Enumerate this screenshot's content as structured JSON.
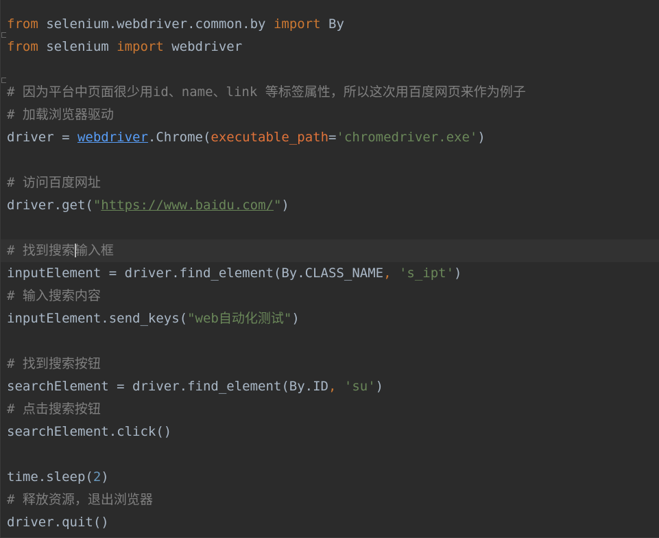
{
  "editor": {
    "lines": [
      [
        {
          "t": "kw",
          "v": "from"
        },
        {
          "t": "id",
          "v": " selenium.webdriver.common.by "
        },
        {
          "t": "kw",
          "v": "import"
        },
        {
          "t": "id",
          "v": " By"
        }
      ],
      [
        {
          "t": "kw",
          "v": "from"
        },
        {
          "t": "id",
          "v": " selenium "
        },
        {
          "t": "kw",
          "v": "import"
        },
        {
          "t": "id",
          "v": " webdriver"
        }
      ],
      [],
      [
        {
          "t": "cm",
          "v": "# 因为平台中页面很少用id、name、link 等标签属性，所以这次用百度网页来作为例子"
        }
      ],
      [
        {
          "t": "cm",
          "v": "# 加载浏览器驱动"
        }
      ],
      [
        {
          "t": "id",
          "v": "driver = "
        },
        {
          "t": "link",
          "v": "webdriver"
        },
        {
          "t": "id",
          "v": ".Chrome("
        },
        {
          "t": "param",
          "v": "executable_path"
        },
        {
          "t": "id",
          "v": "="
        },
        {
          "t": "str",
          "v": "'chromedriver.exe'"
        },
        {
          "t": "id",
          "v": ")"
        }
      ],
      [],
      [
        {
          "t": "cm",
          "v": "# 访问百度网址"
        }
      ],
      [
        {
          "t": "id",
          "v": "driver.get("
        },
        {
          "t": "str",
          "v": "\""
        },
        {
          "t": "url",
          "v": "https://www.baidu.com/"
        },
        {
          "t": "str",
          "v": "\""
        },
        {
          "t": "id",
          "v": ")"
        }
      ],
      [],
      [
        {
          "t": "cm",
          "v": "# 找到搜索输入框"
        }
      ],
      [
        {
          "t": "id",
          "v": "inputElement = driver.find_element(By.CLASS_NAME"
        },
        {
          "t": "punc",
          "v": ", "
        },
        {
          "t": "str",
          "v": "'s_ipt'"
        },
        {
          "t": "id",
          "v": ")"
        }
      ],
      [
        {
          "t": "cm",
          "v": "# 输入搜索内容"
        }
      ],
      [
        {
          "t": "id",
          "v": "inputElement.send_keys("
        },
        {
          "t": "str",
          "v": "\"web自动化测试\""
        },
        {
          "t": "id",
          "v": ")"
        }
      ],
      [],
      [
        {
          "t": "cm",
          "v": "# 找到搜索按钮"
        }
      ],
      [
        {
          "t": "id",
          "v": "searchElement = driver.find_element(By.ID"
        },
        {
          "t": "punc",
          "v": ", "
        },
        {
          "t": "str",
          "v": "'su'"
        },
        {
          "t": "id",
          "v": ")"
        }
      ],
      [
        {
          "t": "cm",
          "v": "# 点击搜索按钮"
        }
      ],
      [
        {
          "t": "id",
          "v": "searchElement.click()"
        }
      ],
      [],
      [
        {
          "t": "id",
          "v": "time.sleep("
        },
        {
          "t": "num",
          "v": "2"
        },
        {
          "t": "id",
          "v": ")"
        }
      ],
      [
        {
          "t": "cm",
          "v": "# 释放资源，退出浏览器"
        }
      ],
      [
        {
          "t": "id",
          "v": "driver.quit()"
        }
      ]
    ],
    "current_line": 10,
    "fold_markers": [
      1,
      3
    ],
    "colors": {
      "background": "#2b2b2b",
      "current_line": "#323232",
      "keyword": "#cc7832",
      "identifier": "#a9b7c6",
      "comment": "#808080",
      "string": "#6a8759",
      "parameter": "#e0733a",
      "link": "#589df6",
      "number": "#6897bb"
    }
  }
}
